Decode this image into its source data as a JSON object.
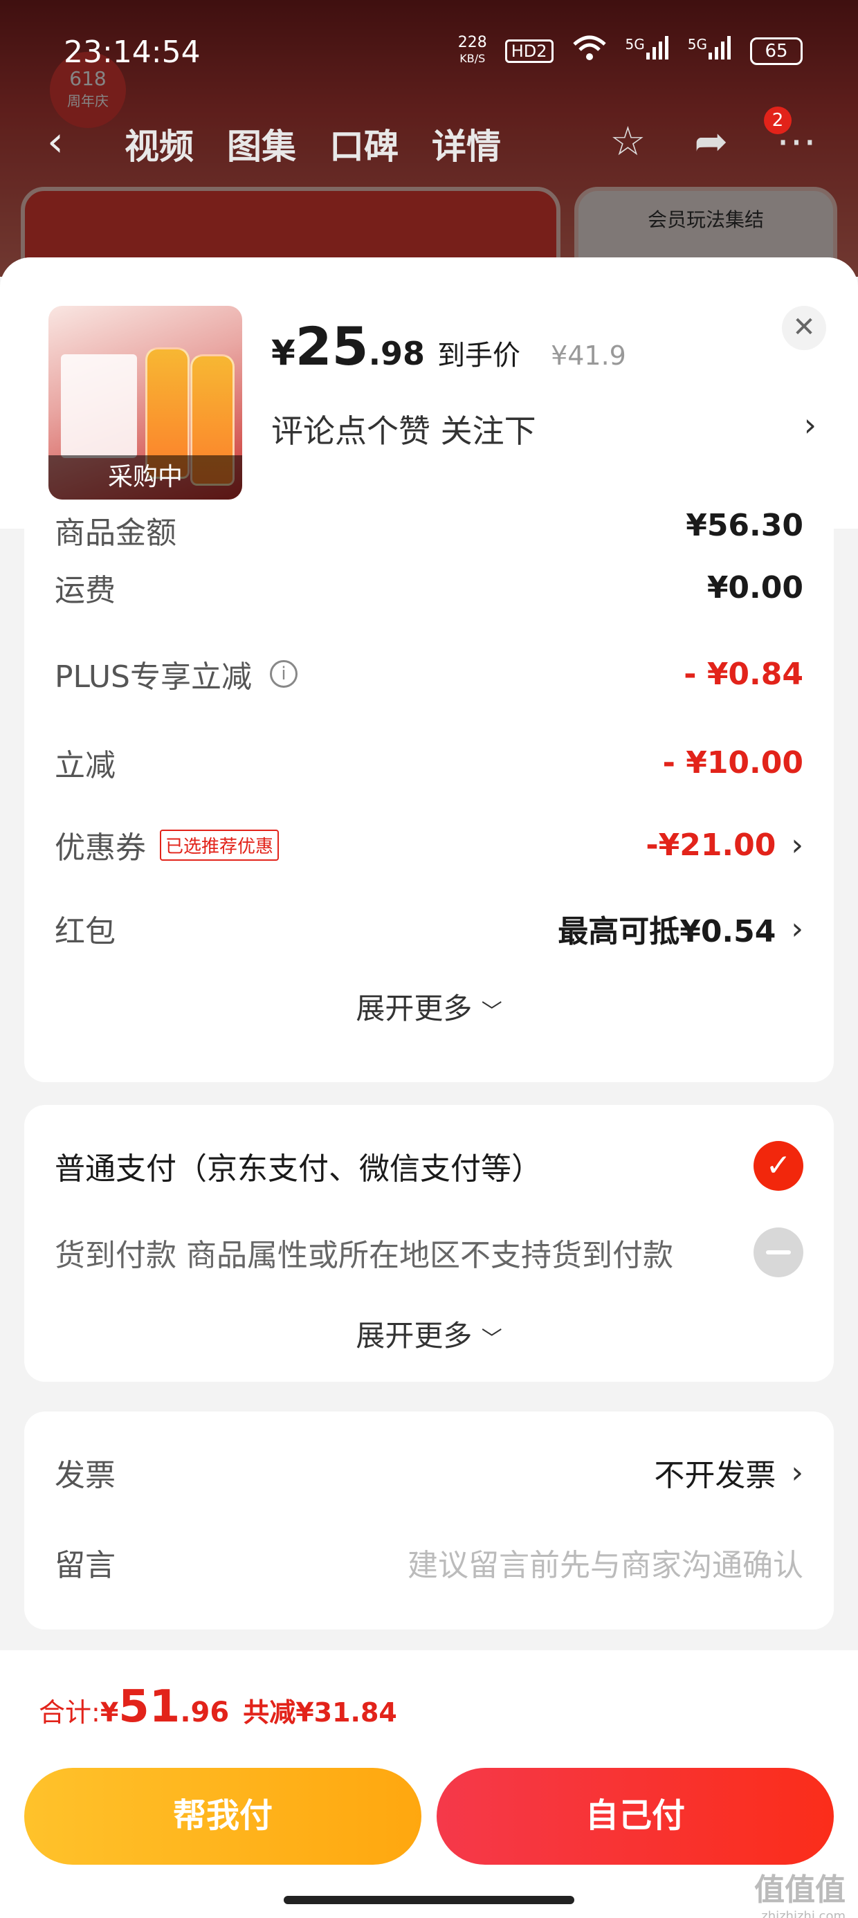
{
  "status_bar": {
    "time": "23:14:54",
    "net_speed": "228",
    "net_unit": "KB/S",
    "hd": "HD2",
    "sig1": "5G",
    "sig2": "5G",
    "battery": "65"
  },
  "bg_nav": {
    "tabs": [
      "视频",
      "图集",
      "口碑",
      "详情"
    ],
    "badge": "2",
    "icons": [
      "back-icon",
      "star-icon",
      "share-icon",
      "more-icon"
    ]
  },
  "bg_brand": {
    "badge_text": "618",
    "badge_sub": "周年庆",
    "panel_title": "会员玩法集结"
  },
  "product": {
    "thumb_tag": "采购中",
    "currency": "¥",
    "price_int": "25",
    "price_dec": ".98",
    "price_label": "到手价",
    "original_price": "¥41.9",
    "spec": "评论点个赞  关注下",
    "close_icon": "close-icon"
  },
  "amounts": {
    "cut_label": "商品金额",
    "cut_value": "¥56.30",
    "rows": [
      {
        "label": "运费",
        "value": "¥0.00",
        "red": false
      },
      {
        "label": "PLUS专享立减",
        "value": "- ¥0.84",
        "red": true
      },
      {
        "label": "立减",
        "value": "- ¥10.00",
        "red": true
      },
      {
        "label": "优惠券",
        "tag": "已选推荐优惠",
        "value": "-¥21.00",
        "red": true
      },
      {
        "label": "红包",
        "value": "最高可抵¥0.54",
        "red": false
      }
    ],
    "expand": "展开更多"
  },
  "payment": {
    "options": [
      {
        "label": "普通支付（京东支付、微信支付等）",
        "state": "selected"
      },
      {
        "label": "货到付款 商品属性或所在地区不支持货到付款",
        "state": "disabled"
      }
    ],
    "expand": "展开更多"
  },
  "other": {
    "invoice_label": "发票",
    "invoice_value": "不开发票",
    "note_label": "留言",
    "note_placeholder": "建议留言前先与商家沟通确认"
  },
  "footer": {
    "total_label": "合计:",
    "currency": "¥",
    "total_int": "51",
    "total_dec": ".96",
    "saved": "共减¥31.84",
    "btn_friend": "帮我付",
    "btn_self": "自己付",
    "watermark": "值值值",
    "watermark_url": "zhizhizhi.com"
  },
  "colors": {
    "accent_red": "#e2231a",
    "friend_btn": "#ffb41b",
    "self_btn": "#f7303a"
  }
}
